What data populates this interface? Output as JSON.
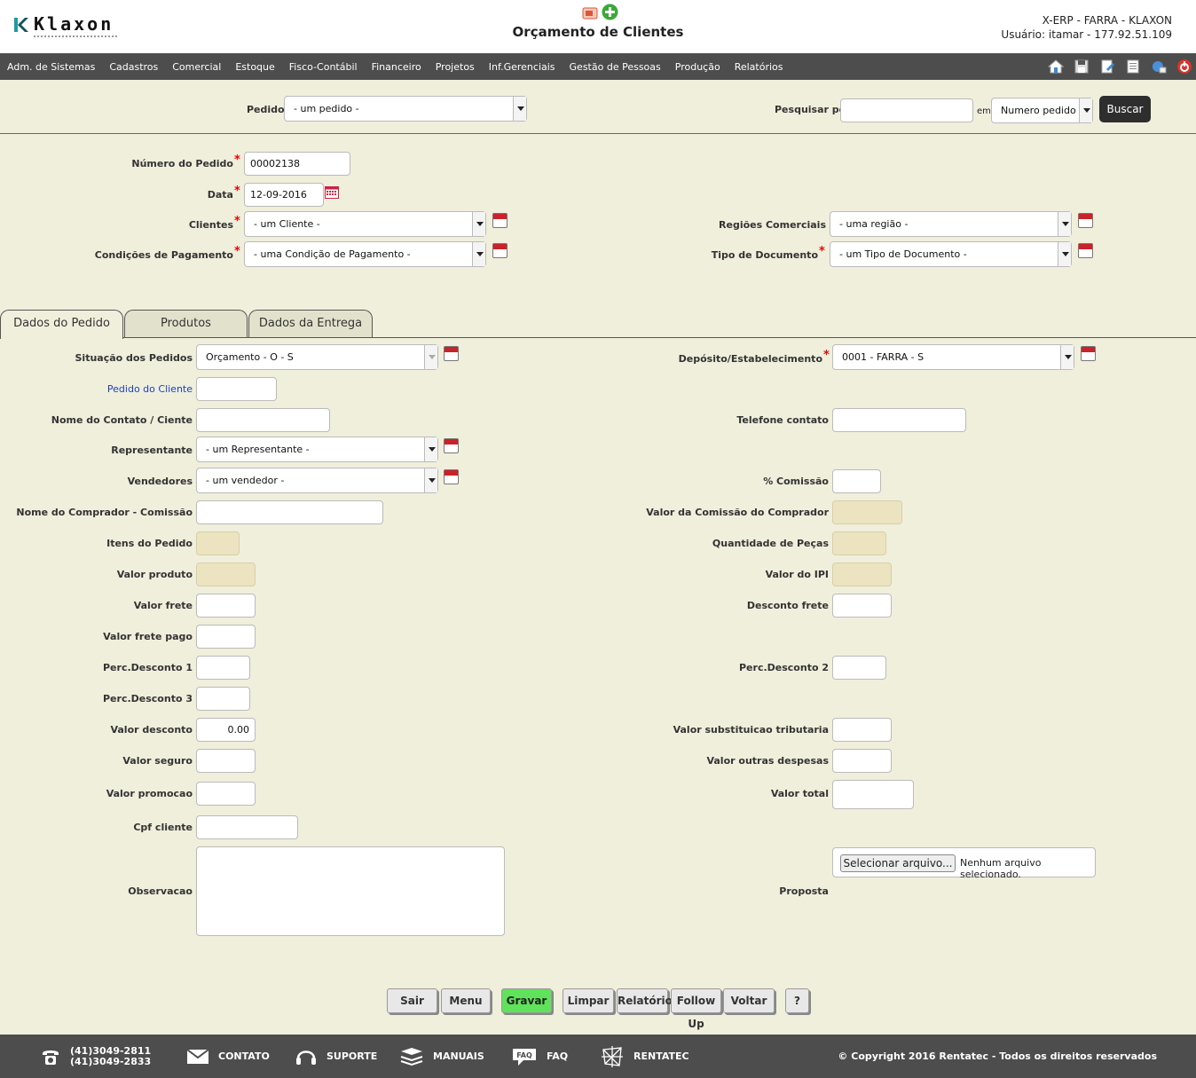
{
  "header": {
    "brand": "Klaxon",
    "title": "Orçamento de Clientes",
    "system": "X-ERP - FARRA - KLAXON",
    "user": "Usuário: itamar - 177.92.51.109"
  },
  "menu": [
    "Adm. de Sistemas",
    "Cadastros",
    "Comercial",
    "Estoque",
    "Fisco-Contábil",
    "Financeiro",
    "Projetos",
    "Inf.Gerenciais",
    "Gestão de Pessoas",
    "Produção",
    "Relatórios"
  ],
  "toolbar_icons": [
    "home-icon",
    "save-icon",
    "edit-icon",
    "document-icon",
    "help-icon",
    "exit-icon"
  ],
  "search": {
    "pedidos_label": "Pedidos",
    "pedidos_value": "- um pedido -",
    "pesquisar_label": "Pesquisar por:",
    "pesquisar_value": "",
    "em_label": "em",
    "field_value": "Numero pedido",
    "buscar": "Buscar"
  },
  "header_form": {
    "numero_label": "Número do Pedido",
    "numero_value": "00002138",
    "data_label": "Data",
    "data_value": "12-09-2016",
    "clientes_label": "Clientes",
    "clientes_value": "- um Cliente -",
    "condicoes_label": "Condições de Pagamento",
    "condicoes_value": "- uma Condição de Pagamento -",
    "regioes_label": "Regiões Comerciais",
    "regioes_value": "- uma região -",
    "tipo_doc_label": "Tipo de Documento",
    "tipo_doc_value": "- um Tipo de Documento -"
  },
  "tabs": [
    "Dados do Pedido",
    "Produtos",
    "Dados da Entrega"
  ],
  "form": {
    "situacao_label": "Situação dos Pedidos",
    "situacao_value": "Orçamento - O - S",
    "pedido_cliente_label": "Pedido do Cliente",
    "nome_contato_label": "Nome do Contato / Ciente",
    "representante_label": "Representante",
    "representante_value": "- um Representante -",
    "vendedores_label": "Vendedores",
    "vendedores_value": "- um vendedor -",
    "comprador_label": "Nome do Comprador - Comissão",
    "itens_label": "Itens do Pedido",
    "valor_produto_label": "Valor produto",
    "valor_frete_label": "Valor frete",
    "valor_frete_pago_label": "Valor frete pago",
    "perc1_label": "Perc.Desconto 1",
    "perc3_label": "Perc.Desconto 3",
    "valor_desconto_label": "Valor desconto",
    "valor_desconto_value": "0.00",
    "valor_seguro_label": "Valor seguro",
    "valor_promocao_label": "Valor promocao",
    "cpf_label": "Cpf cliente",
    "observacao_label": "Observacao",
    "deposito_label": "Depósito/Estabelecimento",
    "deposito_value": "0001 - FARRA - S",
    "telefone_label": "Telefone contato",
    "comissao_label": "% Comissão",
    "valor_comissao_label": "Valor da Comissão do Comprador",
    "qtd_pecas_label": "Quantidade de Peças",
    "valor_ipi_label": "Valor do IPI",
    "desconto_frete_label": "Desconto frete",
    "perc2_label": "Perc.Desconto 2",
    "valor_st_label": "Valor substituicao tributaria",
    "valor_outras_label": "Valor outras despesas",
    "valor_total_label": "Valor total",
    "proposta_label": "Proposta",
    "file_button": "Selecionar arquivo...",
    "file_status": "Nenhum arquivo selecionado."
  },
  "buttons": {
    "sair": "Sair",
    "menu": "Menu",
    "gravar": "Gravar",
    "limpar": "Limpar",
    "relatorio": "Relatório",
    "follow_up": "Follow Up",
    "voltar": "Voltar",
    "help": "?"
  },
  "footer": {
    "phone1": "(41)3049-2811",
    "phone2": "(41)3049-2833",
    "contato": "CONTATO",
    "suporte": "SUPORTE",
    "manuais": "MANUAIS",
    "faq": "FAQ",
    "faq_icon_text": "FAQ",
    "rentatec": "RENTATEC",
    "copyright": "© Copyright 2016 Rentatec - Todos os direitos reservados"
  },
  "colors": {
    "background": "#efefdc",
    "menubar": "#4d4d4d",
    "required": "#ee0000",
    "link_label": "#1a3fc9",
    "gravar": "#5fe35a",
    "readonly_field": "#ece4c0"
  }
}
